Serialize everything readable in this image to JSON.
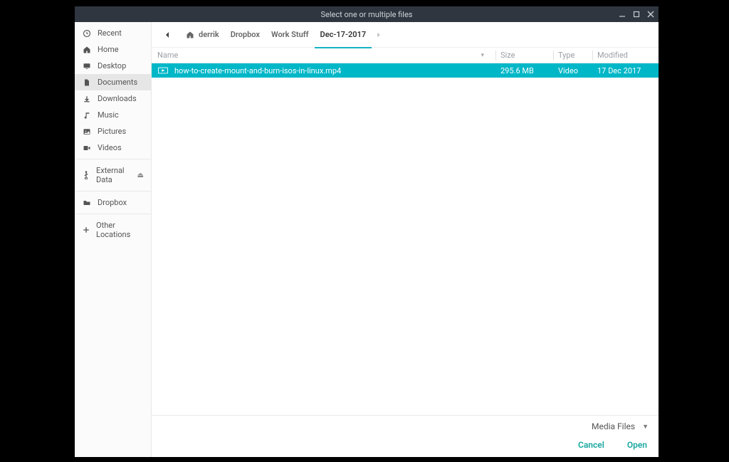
{
  "window": {
    "title": "Select one or multiple files"
  },
  "sidebar": {
    "items": [
      {
        "icon": "clock-icon",
        "label": "Recent"
      },
      {
        "icon": "home-icon",
        "label": "Home"
      },
      {
        "icon": "desktop-icon",
        "label": "Desktop"
      },
      {
        "icon": "document-icon",
        "label": "Documents",
        "selected": true
      },
      {
        "icon": "download-icon",
        "label": "Downloads"
      },
      {
        "icon": "music-icon",
        "label": "Music"
      },
      {
        "icon": "pictures-icon",
        "label": "Pictures"
      },
      {
        "icon": "video-icon",
        "label": "Videos"
      }
    ],
    "devices": [
      {
        "icon": "usb-icon",
        "label": "External Data",
        "ejectable": true
      }
    ],
    "mounts": [
      {
        "icon": "folder-icon",
        "label": "Dropbox"
      }
    ],
    "other": [
      {
        "icon": "plus-icon",
        "label": "Other Locations"
      }
    ]
  },
  "breadcrumb": {
    "segments": [
      {
        "label": "derrik",
        "is_home": true
      },
      {
        "label": "Dropbox"
      },
      {
        "label": "Work Stuff"
      },
      {
        "label": "Dec-17-2017",
        "active": true
      }
    ]
  },
  "columns": {
    "name": "Name",
    "size": "Size",
    "type": "Type",
    "modified": "Modified"
  },
  "files": [
    {
      "name": "how-to-create-mount-and-burn-isos-in-linux.mp4",
      "size": "295.6 MB",
      "type": "Video",
      "modified": "17 Dec 2017",
      "selected": true
    }
  ],
  "footer": {
    "filter_label": "Media Files",
    "cancel": "Cancel",
    "open": "Open"
  }
}
